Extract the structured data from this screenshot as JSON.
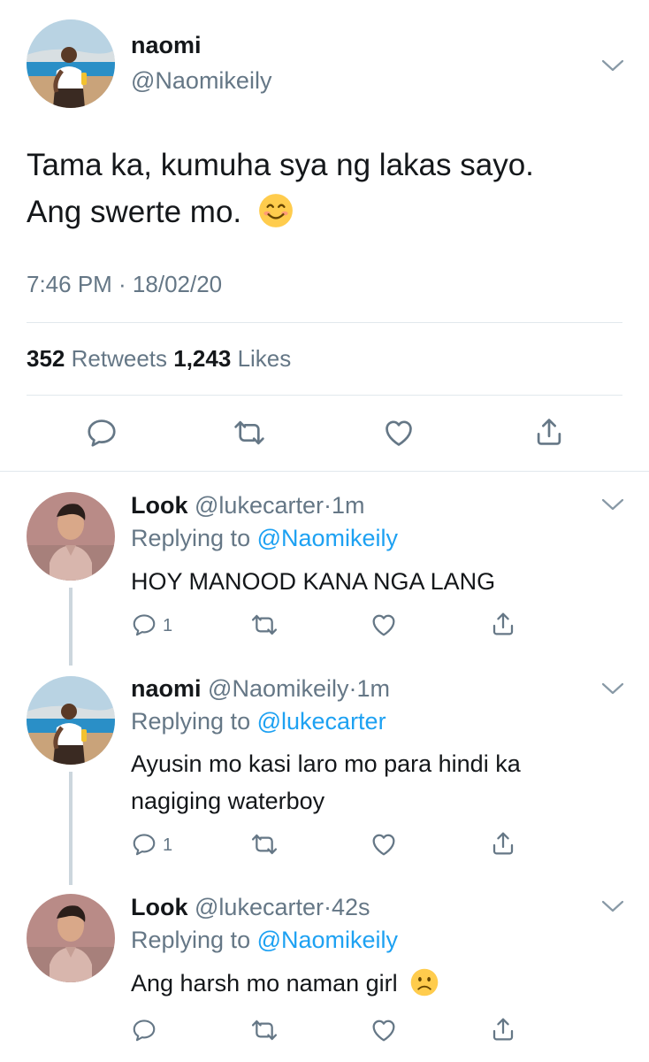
{
  "main_tweet": {
    "name": "naomi",
    "handle": "@Naomikeily",
    "text_line1": "Tama ka, kumuha sya ng lakas sayo.",
    "text_line2": "Ang swerte mo.",
    "text_emoji": "smiling-face",
    "timestamp": "7:46 PM · 18/02/20",
    "retweets_count": "352",
    "retweets_label": "Retweets",
    "likes_count": "1,243",
    "likes_label": "Likes"
  },
  "replies": [
    {
      "name": "Look",
      "handle": "@lukecarter",
      "sep": "·",
      "time": "1m",
      "replying_label": "Replying to",
      "replying_to": "@Naomikeily",
      "text_line1": "HOY MANOOD KANA NGA LANG",
      "reply_count": "1"
    },
    {
      "name": "naomi",
      "handle": "@Naomikeily",
      "sep": "·",
      "time": "1m",
      "replying_label": "Replying to",
      "replying_to": "@lukecarter",
      "text_line1": "Ayusin mo kasi laro mo para hindi ka",
      "text_line2": "nagiging waterboy",
      "reply_count": "1"
    },
    {
      "name": "Look",
      "handle": "@lukecarter",
      "sep": "·",
      "time": "42s",
      "replying_label": "Replying to",
      "replying_to": "@Naomikeily",
      "text_line1": "Ang harsh mo naman girl",
      "text_emoji": "frowning-face"
    }
  ],
  "colors": {
    "accent": "#1da1f2",
    "secondary_text": "#657786",
    "divider": "#e1e8ed",
    "icon": "#657786",
    "emoji": "#ffcc4d"
  }
}
